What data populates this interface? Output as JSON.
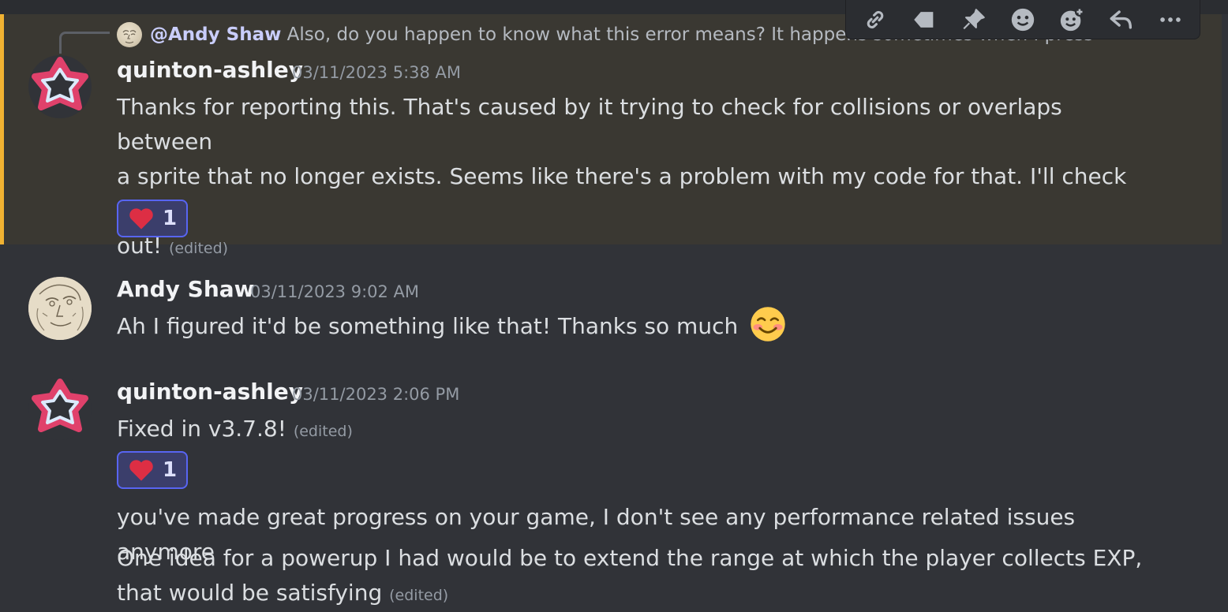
{
  "reply_preview": {
    "mention": "@Andy Shaw",
    "text": "Also, do you happen to know what this error means? It happens sometimes when I press"
  },
  "toolbar": {
    "icons": [
      "link-icon",
      "tag-icon",
      "pin-icon",
      "emoji-icon",
      "add-reaction-icon",
      "reply-icon",
      "more-icon"
    ]
  },
  "messages": [
    {
      "author": "quinton-ashley",
      "timestamp": "03/11/2023 5:38 AM",
      "lines": [
        "Thanks for reporting this. That's caused by it trying to check for collisions or overlaps between",
        "a sprite that no longer exists. Seems like there's a problem with my code for that. I'll check it",
        "out!"
      ],
      "edited": "(edited)",
      "reaction": {
        "emoji": "heart-icon",
        "count": "1"
      }
    },
    {
      "author": "Andy Shaw",
      "timestamp": "03/11/2023 9:02 AM",
      "text": "Ah I figured it'd be something like that! Thanks so much",
      "emoji": "smiling-face-icon"
    },
    {
      "author": "quinton-ashley",
      "timestamp": "03/11/2023 2:06 PM",
      "text": "Fixed in v3.7.8!",
      "edited": "(edited)",
      "reaction": {
        "emoji": "heart-icon",
        "count": "1"
      },
      "followups": [
        "you've made great progress on your game, I don't see any performance related issues anymore",
        "One idea for a powerup I had would be to extend the range at which the player collects EXP,",
        "that would be satisfying"
      ],
      "followup_edited": "(edited)"
    }
  ],
  "colors": {
    "background": "#313338",
    "highlight_bg": "#3a3832",
    "highlight_border": "#f0b232",
    "reaction_border": "#5865f2",
    "avatar_star_outer": "#e0416b"
  }
}
